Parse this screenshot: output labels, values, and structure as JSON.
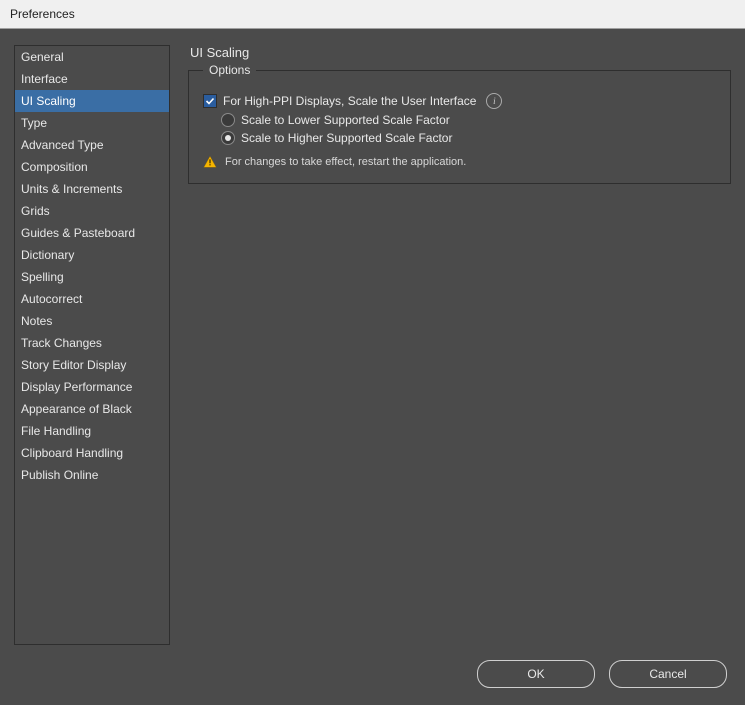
{
  "window": {
    "title": "Preferences"
  },
  "sidebar": {
    "selected_index": 2,
    "items": [
      "General",
      "Interface",
      "UI Scaling",
      "Type",
      "Advanced Type",
      "Composition",
      "Units & Increments",
      "Grids",
      "Guides & Pasteboard",
      "Dictionary",
      "Spelling",
      "Autocorrect",
      "Notes",
      "Track Changes",
      "Story Editor Display",
      "Display Performance",
      "Appearance of Black",
      "File Handling",
      "Clipboard Handling",
      "Publish Online"
    ]
  },
  "main": {
    "heading": "UI Scaling",
    "group_label": "Options",
    "checkbox_label": "For High-PPI Displays, Scale the User Interface",
    "checkbox_checked": true,
    "info_glyph": "i",
    "radio_lower": "Scale to Lower Supported Scale Factor",
    "radio_higher": "Scale to Higher Supported Scale Factor",
    "radio_selected": "higher",
    "warning_text": "For changes to take effect, restart the application."
  },
  "buttons": {
    "ok": "OK",
    "cancel": "Cancel"
  },
  "warn_glyph": "!"
}
